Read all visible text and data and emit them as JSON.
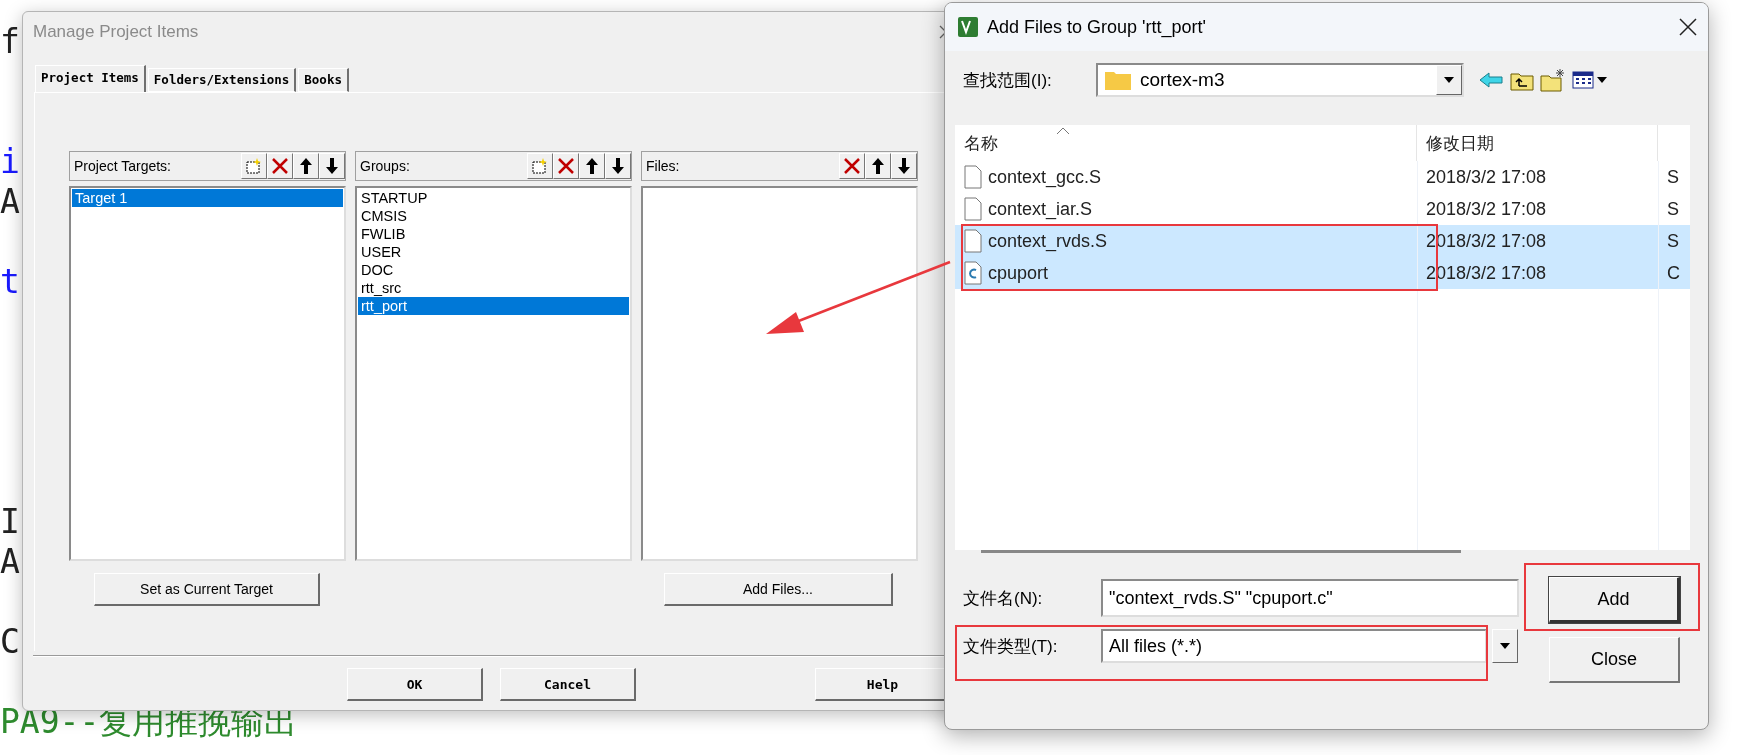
{
  "editor": {
    "lines": [
      {
        "kind": "text",
        "text": "f",
        "color": "#222222"
      },
      {
        "kind": "blank"
      },
      {
        "kind": "blank"
      },
      {
        "kind": "text",
        "text": "i",
        "color": "#1a1aff"
      },
      {
        "kind": "text",
        "text": "A",
        "color": "#222222"
      },
      {
        "kind": "blank"
      },
      {
        "kind": "text",
        "text": "t",
        "color": "#1a1aff"
      },
      {
        "kind": "blank"
      },
      {
        "kind": "blank"
      },
      {
        "kind": "blank"
      },
      {
        "kind": "blank"
      },
      {
        "kind": "blank"
      },
      {
        "kind": "text",
        "text": "I",
        "color": "#222222"
      },
      {
        "kind": "text",
        "text": "A",
        "color": "#222222"
      },
      {
        "kind": "blank"
      },
      {
        "kind": "text",
        "text": "C",
        "color": "#222222"
      },
      {
        "kind": "blank"
      },
      {
        "kind": "text",
        "text": "PA9--复用推挽输出",
        "color": "#2e8b2e"
      }
    ]
  },
  "manage_dialog": {
    "title": "Manage Project Items",
    "tabs": [
      {
        "label": "Project Items",
        "selected": true
      },
      {
        "label": "Folders/Extensions",
        "selected": false
      },
      {
        "label": "Books",
        "selected": false
      }
    ],
    "panels": [
      {
        "title": "Project Targets:",
        "tools": [
          {
            "kind": "new"
          },
          {
            "kind": "delete"
          },
          {
            "kind": "up"
          },
          {
            "kind": "down"
          }
        ],
        "items": [
          {
            "label": "Target 1",
            "selected": true
          }
        ],
        "button": "Set as Current Target"
      },
      {
        "title": "Groups:",
        "tools": [
          {
            "kind": "new"
          },
          {
            "kind": "delete"
          },
          {
            "kind": "up"
          },
          {
            "kind": "down"
          }
        ],
        "items": [
          {
            "label": "STARTUP",
            "selected": false
          },
          {
            "label": "CMSIS",
            "selected": false
          },
          {
            "label": "FWLIB",
            "selected": false
          },
          {
            "label": "USER",
            "selected": false
          },
          {
            "label": "DOC",
            "selected": false
          },
          {
            "label": "rtt_src",
            "selected": false
          },
          {
            "label": "rtt_port",
            "selected": true
          }
        ]
      },
      {
        "title": "Files:",
        "tools": [
          {
            "kind": "delete"
          },
          {
            "kind": "up"
          },
          {
            "kind": "down"
          }
        ],
        "button": "Add Files..."
      }
    ],
    "buttons": [
      "OK",
      "Cancel",
      "Help"
    ]
  },
  "add_dialog": {
    "title": "Add Files to Group 'rtt_port'",
    "look_in": {
      "label": "查找范围(I):",
      "value": "cortex-m3"
    },
    "tools": [
      {
        "kind": "back"
      },
      {
        "kind": "up_folder"
      },
      {
        "kind": "new_folder"
      },
      {
        "kind": "view_menu"
      }
    ],
    "columns": [
      "名称",
      "修改日期"
    ],
    "rows": [
      {
        "kind": "document",
        "name": "context_gcc.S",
        "modified": "2018/3/2 17:08",
        "column_3": "S",
        "selected": false
      },
      {
        "kind": "document",
        "name": "context_iar.S",
        "modified": "2018/3/2 17:08",
        "column_3": "S",
        "selected": false
      },
      {
        "kind": "document",
        "name": "context_rvds.S",
        "modified": "2018/3/2 17:08",
        "column_3": "S",
        "selected": true
      },
      {
        "kind": "c_source",
        "name": "cpuport",
        "modified": "2018/3/2 17:08",
        "column_3": "C",
        "selected": true
      }
    ],
    "file_name": {
      "label": "文件名(N):",
      "value": "\"context_rvds.S\" \"cpuport.c\""
    },
    "file_type": {
      "label": "文件类型(T):",
      "value": "All files (*.*)"
    },
    "buttons": [
      {
        "label": "Add",
        "default": true
      },
      {
        "label": "Close",
        "default": false
      }
    ]
  }
}
